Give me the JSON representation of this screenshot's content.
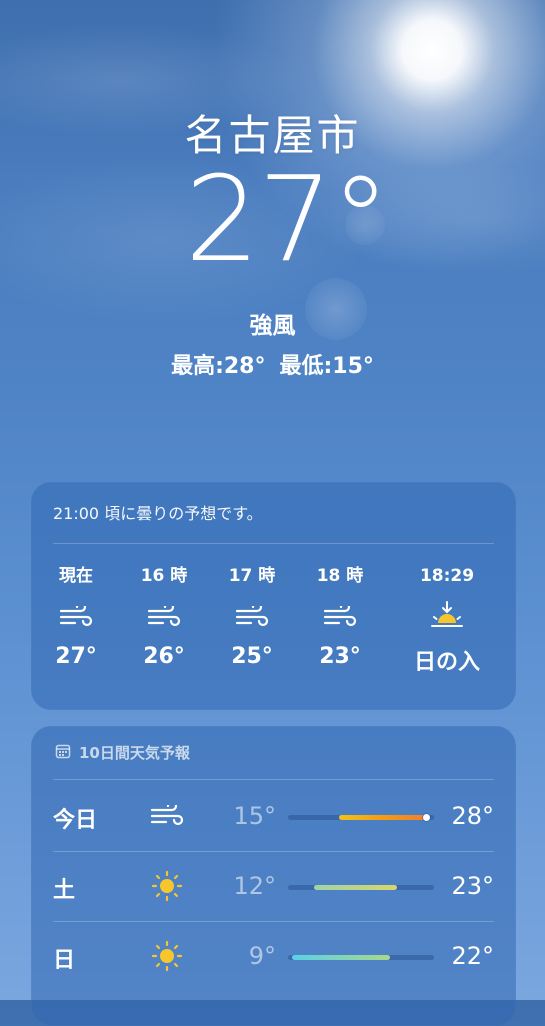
{
  "location": {
    "city": "名古屋市",
    "temperature": "27°",
    "condition": "強風",
    "high": "最高:28°",
    "low": "最低:15°"
  },
  "hourly": {
    "summary": "21:00 頃に曇りの予想です。",
    "items": [
      {
        "time": "現在",
        "icon": "wind-icon",
        "temp": "27°"
      },
      {
        "time": "16 時",
        "icon": "wind-icon",
        "temp": "26°"
      },
      {
        "time": "17 時",
        "icon": "wind-icon",
        "temp": "25°"
      },
      {
        "time": "18 時",
        "icon": "wind-icon",
        "temp": "23°"
      },
      {
        "time": "18:29",
        "icon": "sunset-icon",
        "temp": "日の入"
      }
    ]
  },
  "daily": {
    "title": "10日間天気予報",
    "title_icon": "calendar-icon",
    "days": [
      {
        "name": "今日",
        "icon": "wind-icon",
        "low": "15°",
        "high": "28°",
        "bar_start": 0.35,
        "bar_end": 0.95,
        "current_marker": 0.95,
        "colors": [
          "#f0c419",
          "#f39c12",
          "#f08030"
        ]
      },
      {
        "name": "土",
        "icon": "sun-icon",
        "low": "12°",
        "high": "23°",
        "bar_start": 0.18,
        "bar_end": 0.75,
        "colors": [
          "#9fd3a8",
          "#d9d66a"
        ]
      },
      {
        "name": "日",
        "icon": "sun-icon",
        "low": "9°",
        "high": "22°",
        "bar_start": 0.03,
        "bar_end": 0.7,
        "colors": [
          "#5ad0e6",
          "#a8d88a"
        ]
      }
    ]
  },
  "colors": {
    "sun_yellow": "#f7c62d",
    "card_bg": "#3167b2"
  }
}
